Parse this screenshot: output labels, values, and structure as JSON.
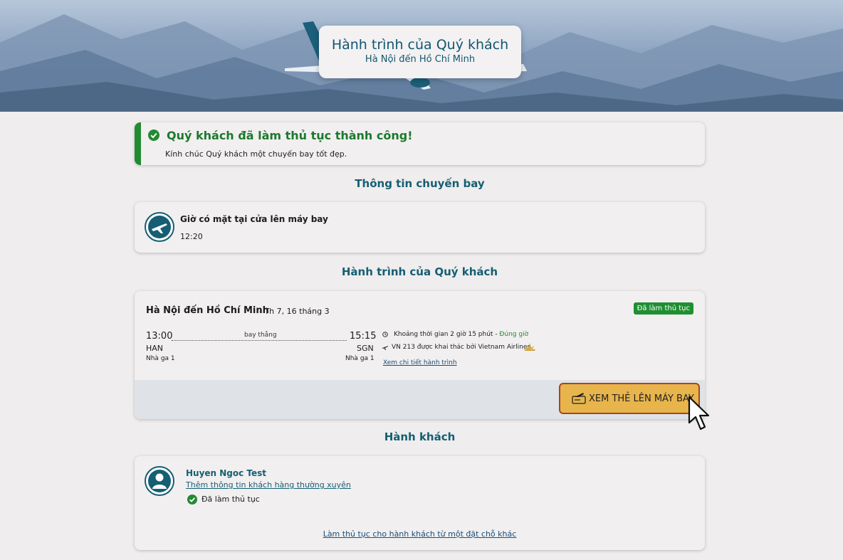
{
  "header": {
    "title": "Hành trình của Quý khách",
    "subtitle": "Hà Nội đến Hồ Chí Minh"
  },
  "success": {
    "title": "Quý khách đã làm thủ tục thành công!",
    "message": "Kính chúc Quý khách một chuyến bay tốt đẹp."
  },
  "flight_info": {
    "section_title": "Thông tin chuyến bay",
    "gate_label": "Giờ có mặt tại cửa lên máy bay",
    "gate_time": "12:20"
  },
  "itinerary": {
    "section_title": "Hành trình của Quý khách",
    "route": "Hà Nội đến Hồ Chí Minh",
    "date": "- Th 7, 16 tháng 3",
    "status_badge": "Đã làm thủ tục",
    "departure": {
      "time": "13:00",
      "code": "HAN",
      "terminal": "Nhà ga 1"
    },
    "arrival": {
      "time": "15:15",
      "code": "SGN",
      "terminal": "Nhà ga 1"
    },
    "stops": "bay thẳng",
    "duration": "Khoảng thời gian 2 giờ 15 phút",
    "punctuality": "Đúng giờ",
    "operator": "VN 213 được khai thác bởi Vietnam Airlines",
    "details_link": "Xem chi tiết hành trình",
    "boarding_pass_button": "XEM THẺ LÊN MÁY BAY"
  },
  "passengers": {
    "section_title": "Hành khách",
    "name": "Huyen Ngoc Test",
    "frequent_flyer_link": "Thêm thông tin khách hàng thường xuyên",
    "checkin_status": "Đã làm thủ tục",
    "other_booking_link": "Làm thủ tục cho hành khách từ một đặt chỗ khác"
  },
  "colors": {
    "brand_teal": "#155e73",
    "success_green": "#218a32",
    "button_gold": "#e8b54c",
    "button_border": "#a74424"
  }
}
